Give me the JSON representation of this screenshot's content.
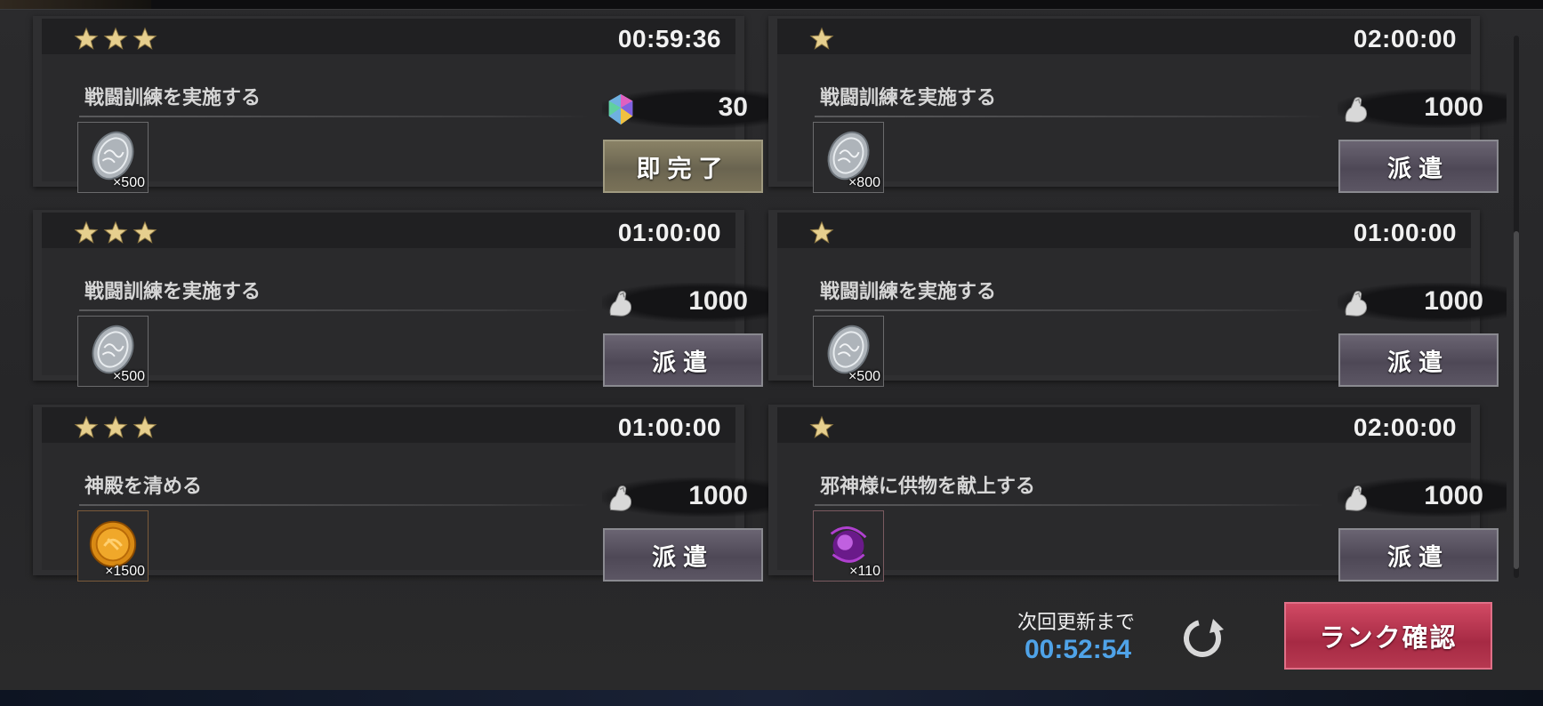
{
  "missions": [
    {
      "stars": 3,
      "timer": "00:59:36",
      "title": "戦闘訓練を実施する",
      "cost_icon": "gem-icon",
      "cost_value": "30",
      "reward_icon": "silver-coin-icon",
      "reward_qty": "×500",
      "button_label": "即完了",
      "button_type": "complete"
    },
    {
      "stars": 1,
      "timer": "02:00:00",
      "title": "戦闘訓練を実施する",
      "cost_icon": "stamina-arm-icon",
      "cost_value": "1000",
      "reward_icon": "silver-coin-icon",
      "reward_qty": "×800",
      "button_label": "派遣",
      "button_type": "dispatch"
    },
    {
      "stars": 3,
      "timer": "01:00:00",
      "title": "戦闘訓練を実施する",
      "cost_icon": "stamina-arm-icon",
      "cost_value": "1000",
      "reward_icon": "silver-coin-icon",
      "reward_qty": "×500",
      "button_label": "派遣",
      "button_type": "dispatch"
    },
    {
      "stars": 1,
      "timer": "01:00:00",
      "title": "戦闘訓練を実施する",
      "cost_icon": "stamina-arm-icon",
      "cost_value": "1000",
      "reward_icon": "silver-coin-icon",
      "reward_qty": "×500",
      "button_label": "派遣",
      "button_type": "dispatch"
    },
    {
      "stars": 3,
      "timer": "01:00:00",
      "title": "神殿を清める",
      "cost_icon": "stamina-arm-icon",
      "cost_value": "1000",
      "reward_icon": "gold-coin-icon",
      "reward_qty": "×1500",
      "button_label": "派遣",
      "button_type": "dispatch"
    },
    {
      "stars": 1,
      "timer": "02:00:00",
      "title": "邪神様に供物を献上する",
      "cost_icon": "stamina-arm-icon",
      "cost_value": "1000",
      "reward_icon": "purple-orb-icon",
      "reward_qty": "×110",
      "button_label": "派遣",
      "button_type": "dispatch"
    }
  ],
  "footer": {
    "next_refresh_label": "次回更新まで",
    "next_refresh_timer": "00:52:54",
    "refresh_icon": "refresh-icon",
    "rank_button_label": "ランク確認"
  },
  "colors": {
    "timer_blue": "#4fa3e8",
    "star_gold": "#e6cf8e",
    "rank_button": "#c03a56",
    "dispatch_button": "#5a5462",
    "complete_button": "#7a735a"
  }
}
